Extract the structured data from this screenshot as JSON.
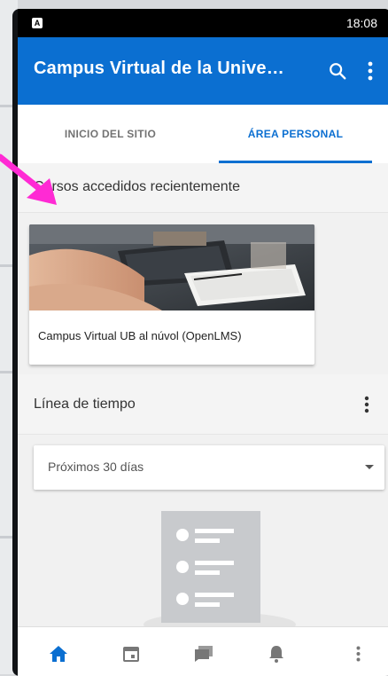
{
  "status_bar": {
    "indicator": "A",
    "time": "18:08"
  },
  "app_bar": {
    "title": "Campus Virtual de la Unive…"
  },
  "tabs": [
    {
      "label": "INICIO DEL SITIO",
      "active": false
    },
    {
      "label": "ÁREA PERSONAL",
      "active": true
    }
  ],
  "recent_courses": {
    "header": "Cursos accedidos recientemente",
    "items": [
      {
        "title": "Campus Virtual UB al núvol (OpenLMS)"
      }
    ]
  },
  "timeline": {
    "header": "Línea de tiempo",
    "filter": {
      "selected": "Próximos 30 días"
    }
  },
  "bottom_nav": {
    "items": [
      "home-icon",
      "calendar-icon",
      "messages-icon",
      "notifications-icon",
      "more-vertical-icon"
    ]
  },
  "colors": {
    "primary": "#0b6fd1",
    "annotation_arrow": "#ff2ad4"
  }
}
